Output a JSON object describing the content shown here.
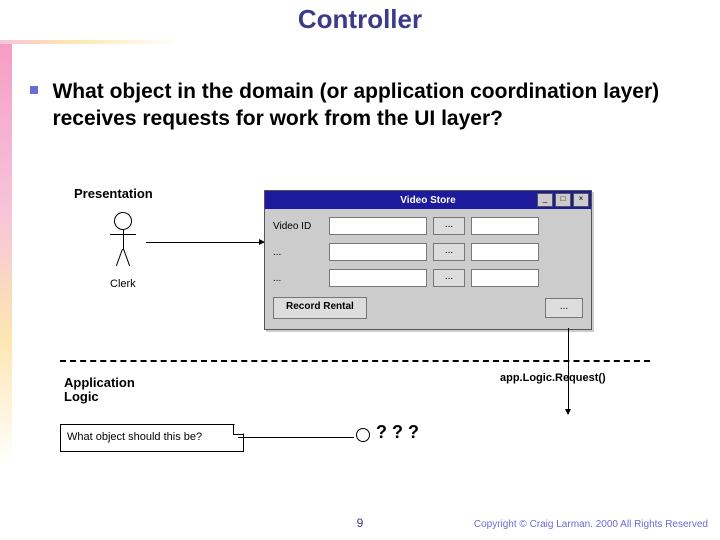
{
  "slide": {
    "title": "Controller",
    "page_number": "9",
    "copyright": "Copyright © Craig Larman. 2000   All Rights Reserved"
  },
  "bullet": {
    "text": "What object in the domain (or application coordination layer) receives requests for work from the UI layer?"
  },
  "diagram": {
    "presentation_label": "Presentation",
    "actor_label": "Clerk",
    "application_logic_label": "Application\nLogic",
    "request_label": "app.Logic.Request()",
    "note_text": "What object should this be?",
    "unknown_object": "? ? ?",
    "window": {
      "title": "Video Store",
      "row1_label": "Video ID",
      "row2_label": "...",
      "row3_label": "...",
      "dots": "...",
      "record_button": "Record Rental"
    }
  }
}
